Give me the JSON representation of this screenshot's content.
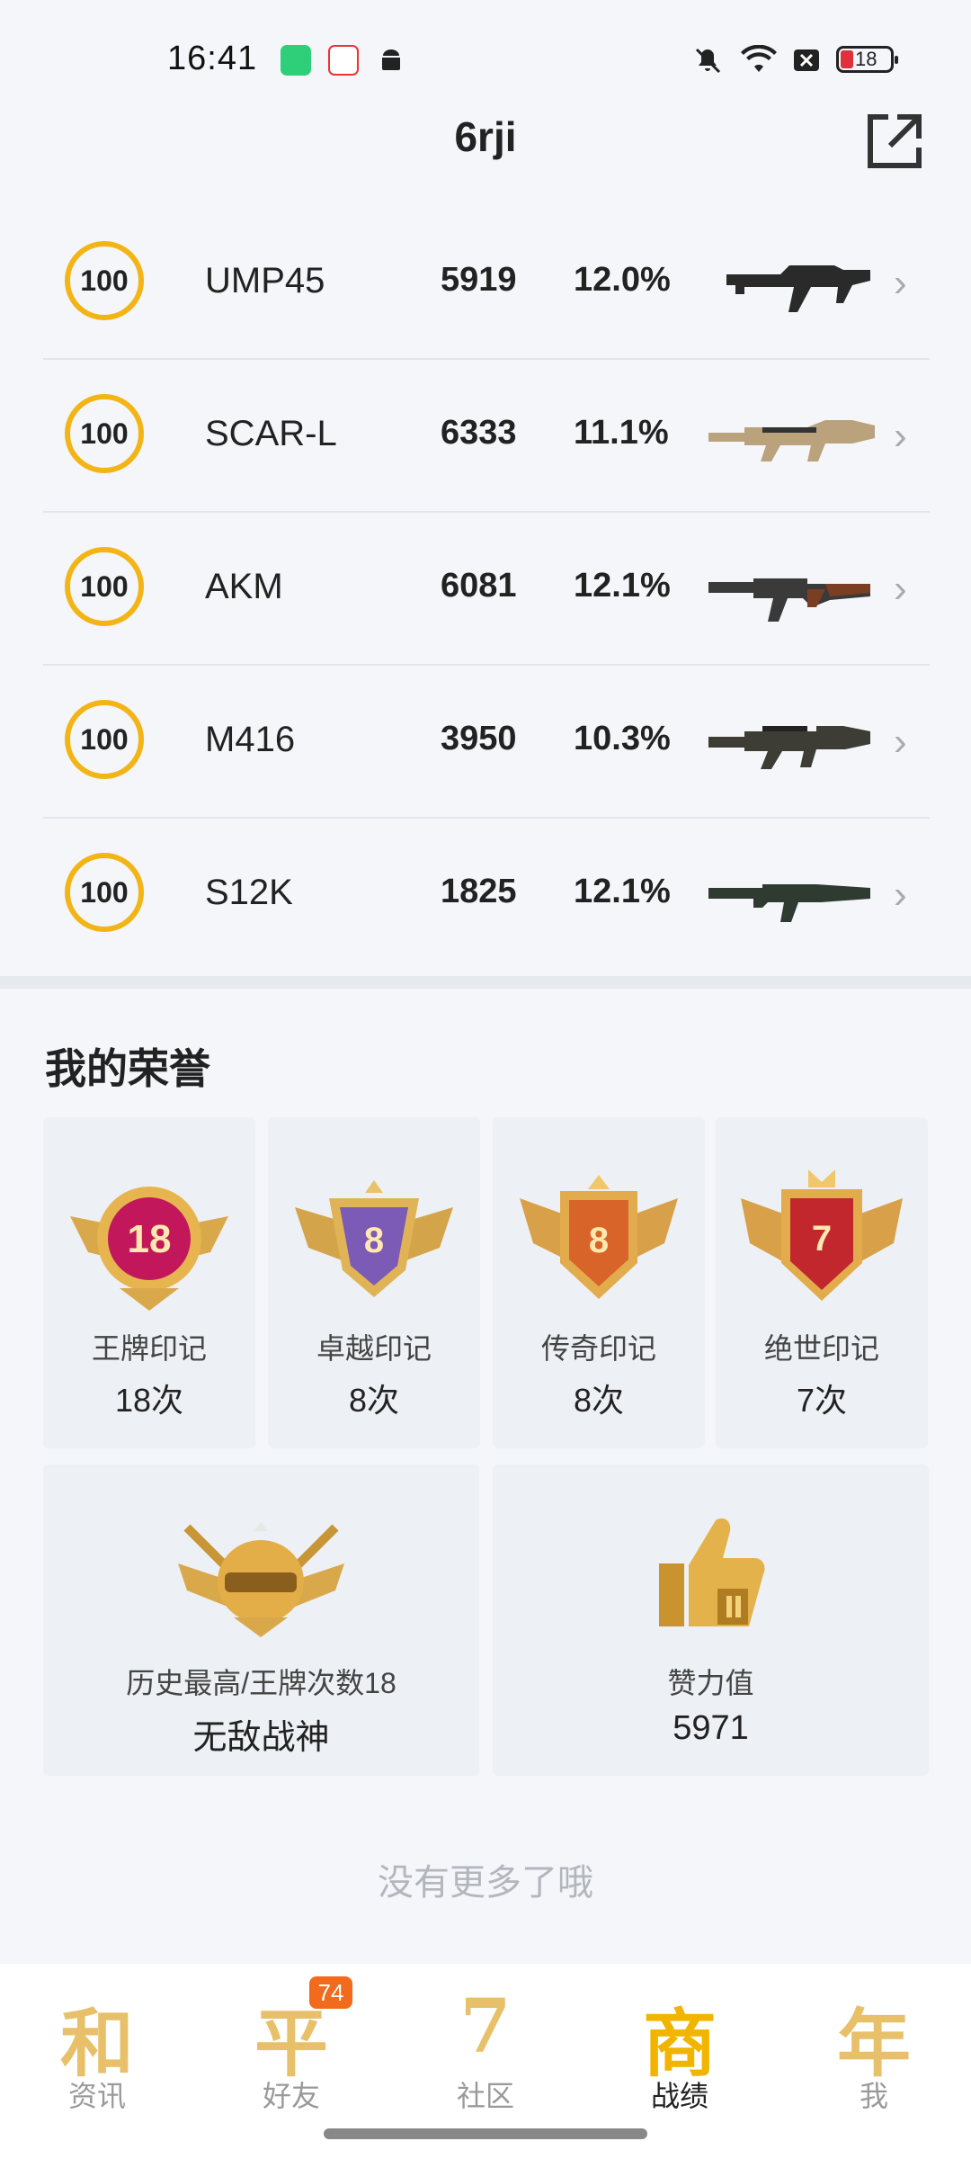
{
  "status": {
    "time": "16:41",
    "battery": "18"
  },
  "header": {
    "title": "6rji"
  },
  "weapons": [
    {
      "level": "100",
      "name": "UMP45",
      "score": "5919",
      "pct": "12.0%"
    },
    {
      "level": "100",
      "name": "SCAR-L",
      "score": "6333",
      "pct": "11.1%"
    },
    {
      "level": "100",
      "name": "AKM",
      "score": "6081",
      "pct": "12.1%"
    },
    {
      "level": "100",
      "name": "M416",
      "score": "3950",
      "pct": "10.3%"
    },
    {
      "level": "100",
      "name": "S12K",
      "score": "1825",
      "pct": "12.1%"
    }
  ],
  "honors": {
    "title": "我的荣誉",
    "badges": [
      {
        "emblem_num": "18",
        "label": "王牌印记",
        "count": "18次",
        "color": "#c2185b"
      },
      {
        "emblem_num": "8",
        "label": "卓越印记",
        "count": "8次",
        "color": "#7b5bb5"
      },
      {
        "emblem_num": "8",
        "label": "传奇印记",
        "count": "8次",
        "color": "#d9642a"
      },
      {
        "emblem_num": "7",
        "label": "绝世印记",
        "count": "7次",
        "color": "#c2272d"
      }
    ],
    "history": {
      "label": "历史最高/王牌次数18",
      "value": "无敌战神"
    },
    "likes": {
      "label": "赞力值",
      "value": "5971"
    }
  },
  "footer_note": "没有更多了哦",
  "tabs": [
    {
      "glyph": "和",
      "label": "资讯",
      "active": false
    },
    {
      "glyph": "平",
      "label": "好友",
      "badge": "74",
      "active": false
    },
    {
      "glyph": "7",
      "label": "社区",
      "active": false
    },
    {
      "glyph": "商",
      "label": "战绩",
      "active": true
    },
    {
      "glyph": "年",
      "label": "我",
      "active": false
    }
  ]
}
